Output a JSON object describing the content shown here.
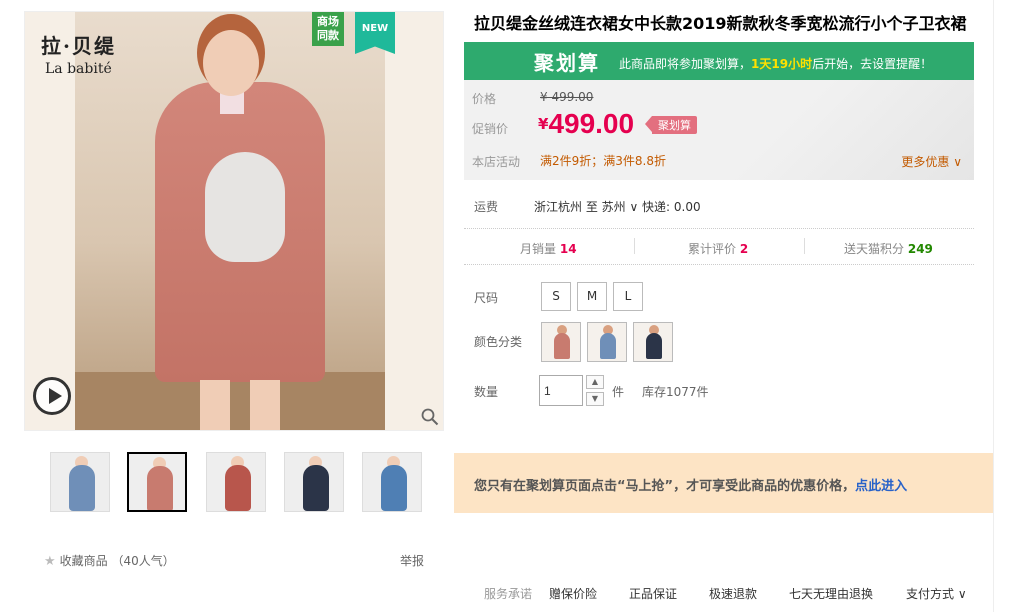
{
  "product": {
    "title": "拉贝缇金丝绒连衣裙女中长款2019新款秋冬季宽松流行小个子卫衣裙"
  },
  "gallery": {
    "brand_cn": "拉·贝缇",
    "brand_en": "La babité",
    "badge_same": "商场\n同款",
    "badge_new": "NEW",
    "thumbnails": [
      {
        "color": "#6f8fb8"
      },
      {
        "color": "#c87b6f"
      },
      {
        "color": "#b8564c"
      },
      {
        "color": "#2b3448"
      },
      {
        "color": "#4f7fb4"
      }
    ],
    "favorite_label": "收藏商品",
    "favorite_count": "（40人气）",
    "report_label": "举报"
  },
  "ju": {
    "logo": "聚划算",
    "msg_pre": "此商品即将参加聚划算，",
    "msg_time": "1天19小时",
    "msg_post": "后开始，去设置提醒！"
  },
  "price": {
    "price_label": "价格",
    "original": "¥ 499.00",
    "promo_label": "促销价",
    "promo_yen": "¥",
    "promo_value": "499.00",
    "promo_tag": "聚划算",
    "activity_label": "本店活动",
    "activity_text": "满2件9折；满3件8.8折",
    "more_promo": "更多优惠"
  },
  "shipping": {
    "label": "运费",
    "value": "浙江杭州 至 苏州 ∨ 快递: 0.00"
  },
  "stats": {
    "monthly_label": "月销量",
    "monthly_value": "14",
    "reviews_label": "累计评价",
    "reviews_value": "2",
    "points_label": "送天猫积分",
    "points_value": "249"
  },
  "options": {
    "size_label": "尺码",
    "sizes": [
      "S",
      "M",
      "L"
    ],
    "color_label": "颜色分类",
    "colors": [
      {
        "color": "#c87b6f"
      },
      {
        "color": "#6f8fb8"
      },
      {
        "color": "#2b3448"
      }
    ],
    "qty_label": "数量",
    "qty_value": "1",
    "unit": "件",
    "stock": "库存1077件"
  },
  "notice": {
    "text": "您只有在聚划算页面点击“马上抢”，才可享受此商品的优惠价格，",
    "link": "点此进入"
  },
  "services": {
    "label": "服务承诺",
    "items": [
      "赠保价险",
      "正品保证",
      "极速退款",
      "七天无理由退换",
      "支付方式 ∨"
    ]
  }
}
